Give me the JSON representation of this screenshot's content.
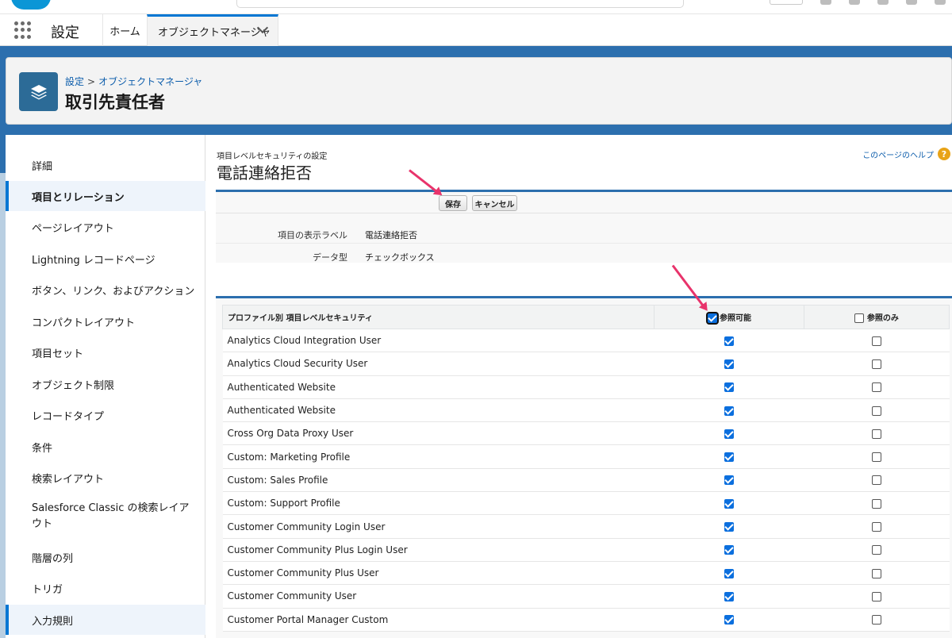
{
  "top_nav": {
    "app_name": "設定",
    "tabs": [
      {
        "label": "ホーム"
      },
      {
        "label": "オブジェクトマネージャ"
      }
    ]
  },
  "header": {
    "breadcrumb": [
      "設定",
      "オブジェクトマネージャ"
    ],
    "breadcrumb_sep": ">",
    "title": "取引先責任者"
  },
  "sidebar": {
    "items": [
      {
        "label": "詳細"
      },
      {
        "label": "項目とリレーション"
      },
      {
        "label": "ページレイアウト"
      },
      {
        "label": "Lightning レコードページ"
      },
      {
        "label": "ボタン、リンク、およびアクション"
      },
      {
        "label": "コンパクトレイアウト"
      },
      {
        "label": "項目セット"
      },
      {
        "label": "オブジェクト制限"
      },
      {
        "label": "レコードタイプ"
      },
      {
        "label": "条件"
      },
      {
        "label": "検索レイアウト"
      },
      {
        "label": "Salesforce Classic の検索レイアウト"
      },
      {
        "label": "階層の列"
      },
      {
        "label": "トリガ"
      },
      {
        "label": "入力規則"
      }
    ]
  },
  "content": {
    "subtitle": "項目レベルセキュリティの設定",
    "title": "電話連絡拒否",
    "help_link": "このページのヘルプ",
    "help_icon": "?",
    "buttons": {
      "save": "保存",
      "cancel": "キャンセル"
    },
    "details": [
      {
        "label": "項目の表示ラベル",
        "value": "電話連絡拒否"
      },
      {
        "label": "データ型",
        "value": "チェックボックス"
      }
    ]
  },
  "table": {
    "headers": {
      "profile": "プロファイル別 項目レベルセキュリティ",
      "visible": "参照可能",
      "readonly": "参照のみ"
    },
    "header_checkboxes": {
      "visible": true,
      "readonly": false
    },
    "rows": [
      {
        "name": "Analytics Cloud Integration User",
        "visible": true,
        "readonly": false
      },
      {
        "name": "Analytics Cloud Security User",
        "visible": true,
        "readonly": false
      },
      {
        "name": "Authenticated Website",
        "visible": true,
        "readonly": false
      },
      {
        "name": "Authenticated Website",
        "visible": true,
        "readonly": false
      },
      {
        "name": "Cross Org Data Proxy User",
        "visible": true,
        "readonly": false
      },
      {
        "name": "Custom: Marketing Profile",
        "visible": true,
        "readonly": false
      },
      {
        "name": "Custom: Sales Profile",
        "visible": true,
        "readonly": false
      },
      {
        "name": "Custom: Support Profile",
        "visible": true,
        "readonly": false
      },
      {
        "name": "Customer Community Login User",
        "visible": true,
        "readonly": false
      },
      {
        "name": "Customer Community Plus Login User",
        "visible": true,
        "readonly": false
      },
      {
        "name": "Customer Community Plus User",
        "visible": true,
        "readonly": false
      },
      {
        "name": "Customer Community User",
        "visible": true,
        "readonly": false
      },
      {
        "name": "Customer Portal Manager Custom",
        "visible": true,
        "readonly": false
      }
    ]
  },
  "colors": {
    "accent": "#0176d3",
    "header_band": "#2c6fae",
    "annotation_arrow": "#e8336b",
    "checkbox_checked": "#0b6fde"
  }
}
